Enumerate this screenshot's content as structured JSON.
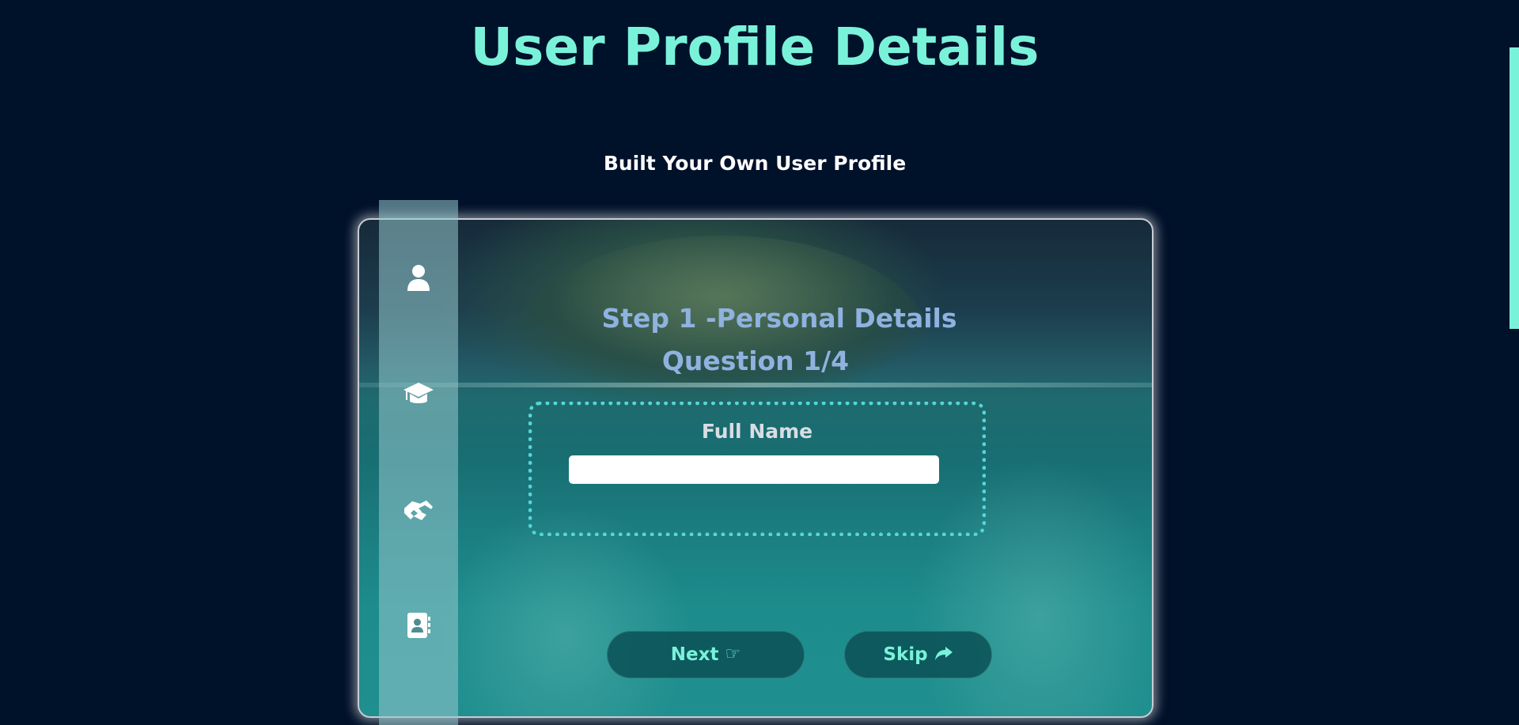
{
  "header": {
    "title": "User Profile Details",
    "subtitle": "Built Your Own User Profile"
  },
  "sidebar": {
    "items": [
      {
        "icon": "user-icon"
      },
      {
        "icon": "graduation-cap-icon"
      },
      {
        "icon": "handshake-icon"
      },
      {
        "icon": "address-book-icon"
      }
    ]
  },
  "form": {
    "step_title": "Step 1 -Personal Details",
    "question_counter": "Question 1/4",
    "field_label": "Full Name",
    "field_value": ""
  },
  "buttons": {
    "next_label": "Next",
    "next_icon": "hand-pointing-right-icon",
    "skip_label": "Skip",
    "skip_icon": "share-arrow-icon"
  },
  "colors": {
    "background": "#00112a",
    "accent": "#7af2da",
    "step_text": "#8fb2e0",
    "dotted_border": "#55d6d8"
  }
}
